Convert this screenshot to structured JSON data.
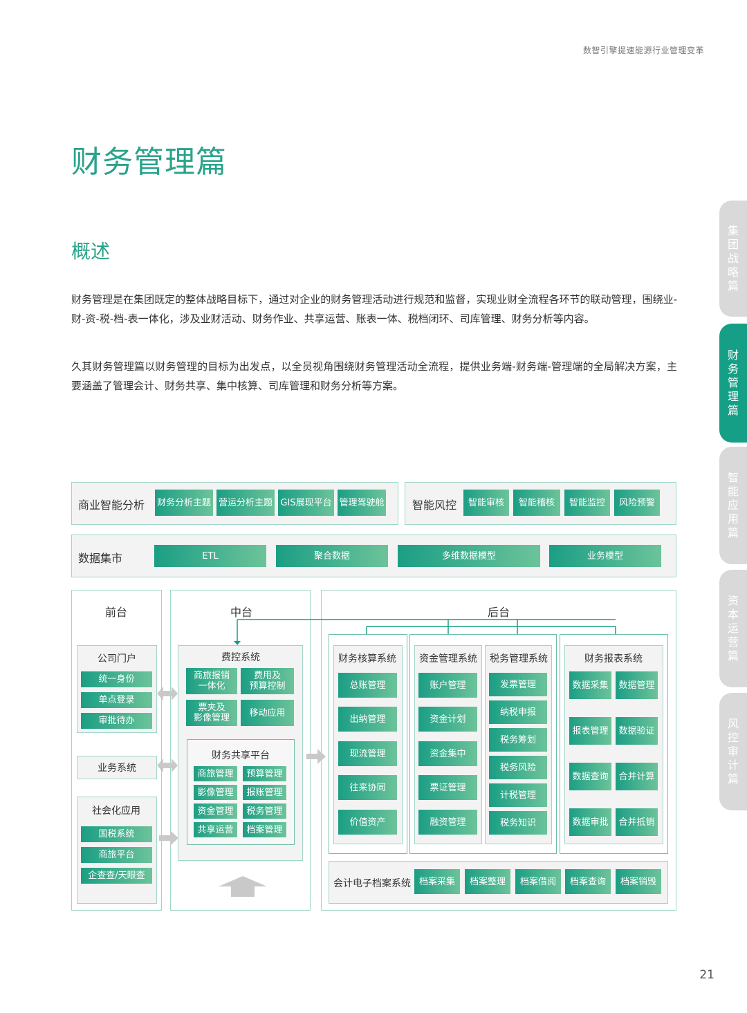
{
  "header": {
    "text": "数智引擎提速能源行业管理变革"
  },
  "page_title": "财务管理篇",
  "section_title": "概述",
  "paragraphs": [
    "财务管理是在集团既定的整体战略目标下，通过对企业的财务管理活动进行规范和监督，实现业财全流程各环节的联动管理，围绕业-财-资-税-档-表一体化，涉及业财活动、财务作业、共享运营、账表一体、税档闭环、司库管理、财务分析等内容。",
    "久其财务管理篇以财务管理的目标为出发点，以全员视角围绕财务管理活动全流程，提供业务端-财务端-管理端的全局解决方案，主要涵盖了管理会计、财务共享、集中核算、司库管理和财务分析等方案。"
  ],
  "side_tabs": [
    {
      "label": "集团战略篇",
      "active": false
    },
    {
      "label": "财务管理篇",
      "active": true
    },
    {
      "label": "智能应用篇",
      "active": false
    },
    {
      "label": "资本运营篇",
      "active": false
    },
    {
      "label": "风控审计篇",
      "active": false
    }
  ],
  "page_number": "21",
  "diagram": {
    "bi": {
      "label": "商业智能分析",
      "items": [
        "财务分析主题",
        "营运分析主题",
        "GIS展现平台",
        "管理驾驶舱"
      ]
    },
    "risk": {
      "label": "智能风控",
      "items": [
        "智能审核",
        "智能稽核",
        "智能监控",
        "风险预警"
      ]
    },
    "datamart": {
      "label": "数据集市",
      "items": [
        "ETL",
        "聚合数据",
        "多维数据模型",
        "业务模型"
      ]
    },
    "front": {
      "label": "前台",
      "portal": {
        "label": "公司门户",
        "items": [
          "统一身份",
          "单点登录",
          "审批待办"
        ]
      },
      "biz": {
        "label": "业务系统"
      },
      "social": {
        "label": "社会化应用",
        "items": [
          "国税系统",
          "商旅平台",
          "企查查/天眼查"
        ]
      }
    },
    "middle": {
      "label": "中台",
      "expense": {
        "label": "费控系统",
        "items": [
          "商旅报销\n一体化",
          "费用及\n预算控制",
          "票夹及\n影像管理",
          "移动应用"
        ]
      },
      "shared": {
        "label": "财务共享平台",
        "items": [
          "商旅管理",
          "预算管理",
          "影像管理",
          "报账管理",
          "资金管理",
          "税务管理",
          "共享运营",
          "档案管理"
        ]
      }
    },
    "back": {
      "label": "后台",
      "accounting": {
        "label": "财务核算系统",
        "items": [
          "总账管理",
          "出纳管理",
          "现流管理",
          "往来协同",
          "价值资产"
        ]
      },
      "treasury": {
        "label": "资金管理系统",
        "items": [
          "账户管理",
          "资金计划",
          "资金集中",
          "票证管理",
          "融资管理"
        ]
      },
      "tax": {
        "label": "税务管理系统",
        "items": [
          "发票管理",
          "纳税申报",
          "税务筹划",
          "税务风险",
          "计税管理",
          "税务知识"
        ]
      },
      "report": {
        "label": "财务报表系统",
        "items": [
          "数据采集",
          "数据管理",
          "报表管理",
          "数据验证",
          "数据查询",
          "合并计算",
          "数据审批",
          "合并抵销"
        ]
      },
      "archive": {
        "label": "会计电子档案系统",
        "items": [
          "档案采集",
          "档案整理",
          "档案借阅",
          "档案查询",
          "档案销毁"
        ]
      }
    }
  }
}
